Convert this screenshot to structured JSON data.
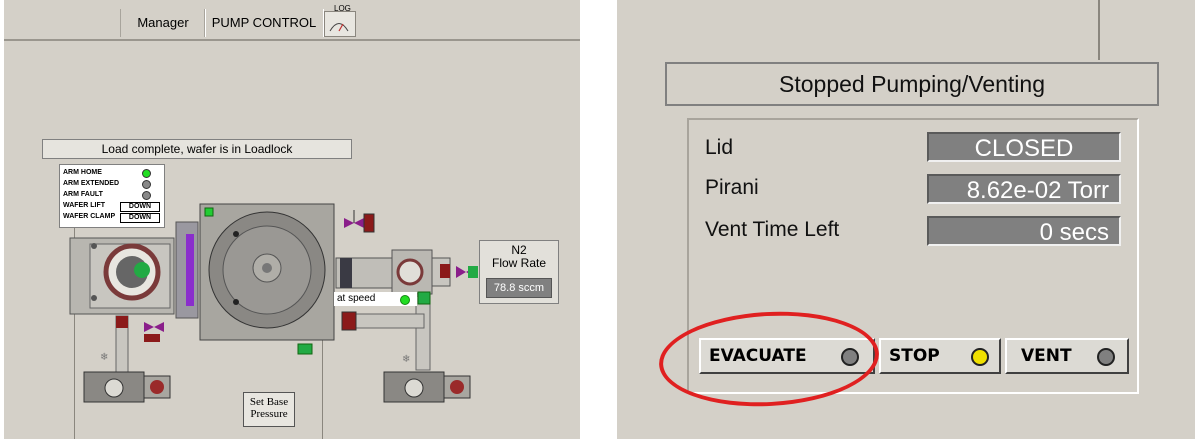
{
  "left": {
    "tabs": {
      "manager": "Manager",
      "pump_control": "PUMP CONTROL",
      "log": "LOG"
    },
    "status_message": "Load complete, wafer is in Loadlock",
    "arm_status": {
      "arm_home": "ARM HOME",
      "arm_extended": "ARM EXTENDED",
      "arm_fault": "ARM FAULT",
      "wafer_lift_label": "WAFER LIFT",
      "wafer_lift_value": "DOWN",
      "wafer_clamp_label": "WAFER CLAMP",
      "wafer_clamp_value": "DOWN"
    },
    "n2": {
      "title_line1": "N2",
      "title_line2": "Flow Rate",
      "value": "78.8 sccm"
    },
    "at_speed_label": "at speed",
    "set_base_pressure": {
      "line1": "Set Base",
      "line2": "Pressure"
    },
    "colors": {
      "led_on": "#22dd22",
      "valve_open": "#22aa44",
      "valve_closed": "#8b1a1a",
      "valve_purple": "#8a1e8a",
      "panel_bg": "#d4d0c8"
    }
  },
  "right": {
    "state_title": "Stopped Pumping/Venting",
    "fields": {
      "lid_label": "Lid",
      "lid_value": "CLOSED",
      "pirani_label": "Pirani",
      "pirani_value": "8.62e-02 Torr",
      "vent_label": "Vent Time Left",
      "vent_value": "0 secs"
    },
    "buttons": {
      "evacuate": "EVACUATE",
      "stop": "STOP",
      "vent": "VENT"
    },
    "colors": {
      "stop_led": "#f0e000",
      "off_led": "#808080",
      "highlight": "#e02020"
    }
  }
}
